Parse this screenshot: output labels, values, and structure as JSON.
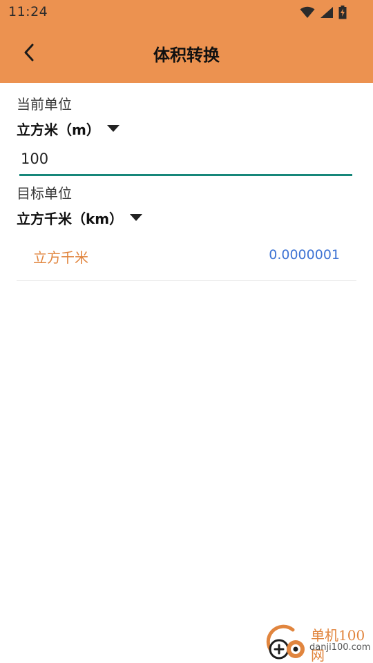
{
  "status_bar": {
    "time": "11:24",
    "icons": [
      "wifi-icon",
      "signal-icon",
      "battery-charging-icon"
    ]
  },
  "toolbar": {
    "back_icon": "chevron-left-icon",
    "title": "体积转换"
  },
  "source": {
    "label": "当前单位",
    "unit": "立方米（m）",
    "value": "100"
  },
  "target": {
    "label": "目标单位",
    "unit": "立方千米（km）"
  },
  "result": {
    "unit_name": "立方千米",
    "value": "0.0000001"
  },
  "watermark": {
    "name": "单机100网",
    "url": "danji100.com"
  },
  "colors": {
    "header": "#ec9250",
    "accent_orange": "#e1853e",
    "input_underline": "#16877a",
    "result_value": "#3f74d4"
  }
}
